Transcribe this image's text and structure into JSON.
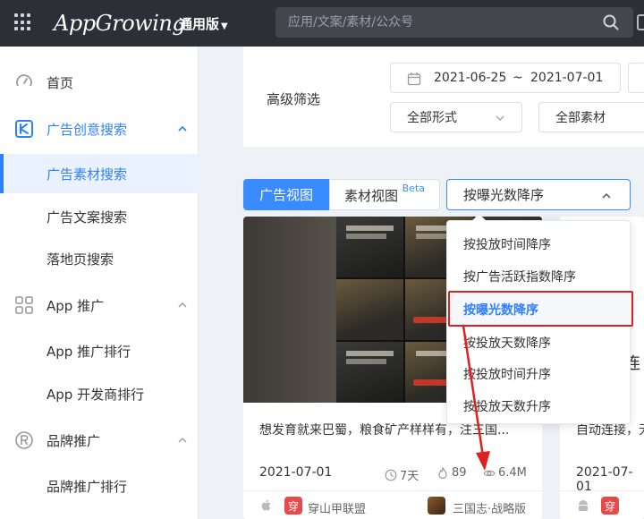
{
  "topbar": {
    "logo_text": "AppGrowing",
    "edition": "通用版",
    "search_placeholder": "应用/文案/素材/公众号"
  },
  "sidebar": {
    "items": [
      {
        "label": "首页",
        "icon": "gauge-icon"
      },
      {
        "label": "广告创意搜索",
        "icon": "creative-icon",
        "expanded": true
      },
      {
        "label": "广告素材搜索",
        "selected": true
      },
      {
        "label": "广告文案搜索"
      },
      {
        "label": "落地页搜索"
      },
      {
        "label": "App 推广",
        "icon": "apps-grid-icon",
        "expanded": true
      },
      {
        "label": "App 推广排行"
      },
      {
        "label": "App 开发商排行"
      },
      {
        "label": "品牌推广",
        "icon": "registered-icon",
        "expanded": true
      },
      {
        "label": "品牌推广排行"
      }
    ]
  },
  "filters": {
    "label": "高级筛选",
    "date_start": "2021-06-25",
    "date_sep": "~",
    "date_end": "2021-07-01",
    "form_select": "全部形式",
    "material_select": "全部素材"
  },
  "view_tabs": {
    "ad_view": "广告视图",
    "material_view": "素材视图",
    "beta": "Beta"
  },
  "sort": {
    "current": "按曝光数降序",
    "options": [
      "按投放时间降序",
      "按广告活跃指数降序",
      "按曝光数降序",
      "按投放天数降序",
      "按投放时间升序",
      "按投放天数升序"
    ],
    "selected_index": 2
  },
  "cards": [
    {
      "title": "想发育就来巴蜀，粮食矿产样样有，注三国...",
      "date": "2021-07-01",
      "days": "7天",
      "activity": "89",
      "views": "6.4M",
      "advertiser_badge": "穿",
      "advertiser": "穿山甲联盟",
      "app": "三国志·战略版"
    },
    {
      "title": "自动连接，无",
      "overlay_text": "连",
      "date": "2021-07-01",
      "advertiser_badge": "穿"
    }
  ],
  "colors": {
    "accent": "#2f7fff",
    "highlight": "#e02020",
    "topbar": "#2c2f36"
  }
}
